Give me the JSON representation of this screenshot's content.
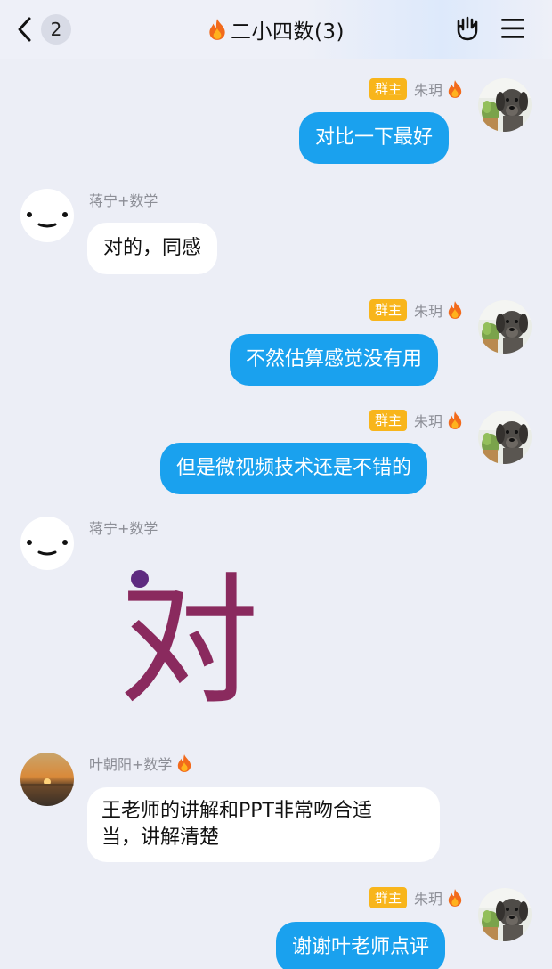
{
  "header": {
    "back_count": "2",
    "title": "二小四数(3)",
    "icons": [
      "back-chevron-icon",
      "fire-icon",
      "hand-gesture-icon",
      "menu-icon"
    ]
  },
  "messages": [
    {
      "side": "right",
      "badge": "群主",
      "sender": "朱玥",
      "text": "对比一下最好",
      "avatar": "dog-photo"
    },
    {
      "side": "left",
      "sender": "蒋宁+数学",
      "text": "对的，同感",
      "avatar": "smiley-face"
    },
    {
      "side": "right",
      "badge": "群主",
      "sender": "朱玥",
      "text": "不然估算感觉没有用",
      "avatar": "dog-photo"
    },
    {
      "side": "right",
      "badge": "群主",
      "sender": "朱玥",
      "text": "但是微视频技术还是不错的",
      "avatar": "dog-photo"
    },
    {
      "side": "left",
      "sender": "蒋宁+数学",
      "sticker_text": "对",
      "avatar": "smiley-face"
    },
    {
      "side": "left",
      "sender": "叶朝阳+数学",
      "text_line1": "王老师的讲解和PPT非常吻合适",
      "text_line2": "当，讲解清楚",
      "avatar": "sunset-photo"
    },
    {
      "side": "right",
      "badge": "群主",
      "sender": "朱玥",
      "text": "谢谢叶老师点评",
      "avatar": "dog-photo"
    }
  ],
  "colors": {
    "background": "#eceef6",
    "outgoing_bubble": "#1aa1ee",
    "incoming_bubble": "#ffffff",
    "owner_badge": "#f8b51b",
    "sticker": "#8a2a5e"
  }
}
